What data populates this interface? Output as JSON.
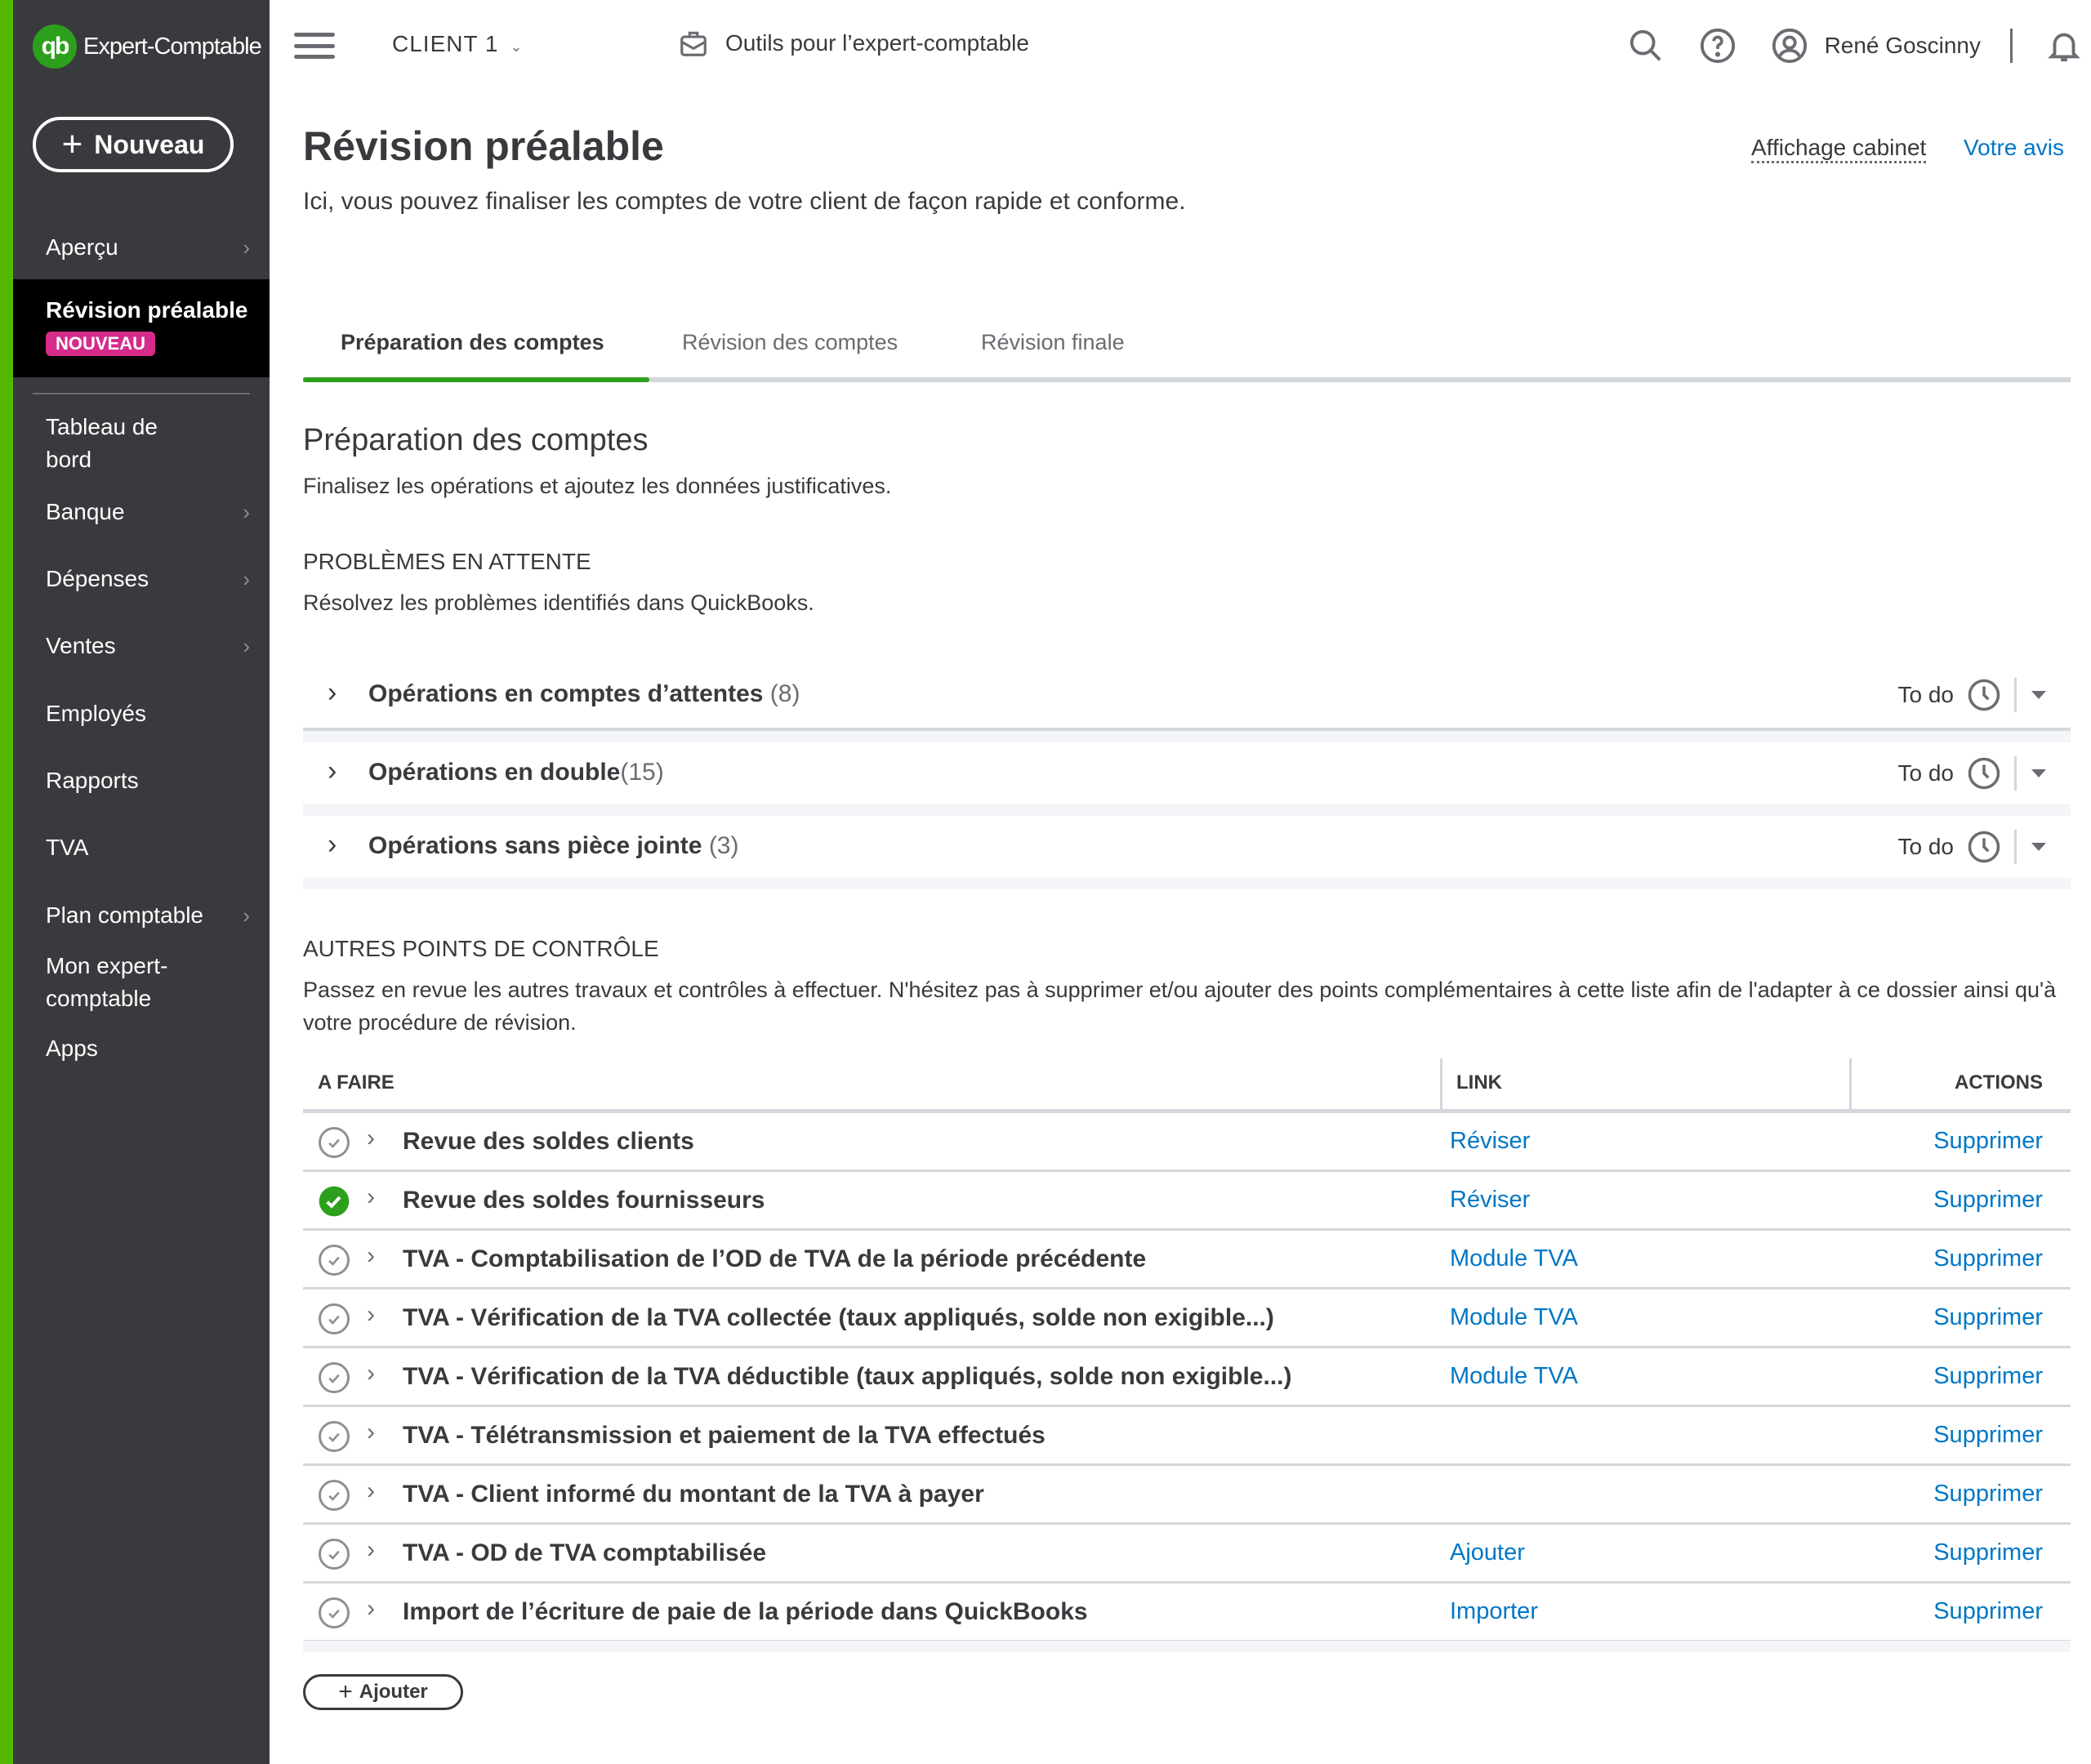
{
  "app": {
    "logo_mark": "qb",
    "logo_text": "Expert-Comptable"
  },
  "sidebar": {
    "new_button": "Nouveau",
    "items": [
      {
        "label": "Aperçu",
        "has_chevron": true
      },
      {
        "label": "Révision préalable",
        "badge": "NOUVEAU",
        "active": true
      },
      {
        "label": "Tableau de bord",
        "has_chevron": false
      },
      {
        "label": "Banque",
        "has_chevron": true
      },
      {
        "label": "Dépenses",
        "has_chevron": true
      },
      {
        "label": "Ventes",
        "has_chevron": true
      },
      {
        "label": "Employés",
        "has_chevron": false
      },
      {
        "label": "Rapports",
        "has_chevron": false
      },
      {
        "label": "TVA",
        "has_chevron": false
      },
      {
        "label": "Plan comptable",
        "has_chevron": true
      },
      {
        "label": "Mon expert-comptable",
        "has_chevron": false
      },
      {
        "label": "Apps",
        "has_chevron": false
      }
    ]
  },
  "topbar": {
    "client": "CLIENT 1",
    "tools": "Outils pour l’expert-comptable",
    "user": "René Goscinny",
    "icons": [
      "hamburger-icon",
      "briefcase-icon",
      "search-icon",
      "help-icon",
      "user-icon",
      "bell-icon"
    ]
  },
  "page": {
    "title": "Révision préalable",
    "subtitle": "Ici, vous pouvez finaliser les comptes de votre client de façon rapide et conforme.",
    "affichage": "Affichage cabinet",
    "avis": "Votre avis",
    "tabs": [
      {
        "label": "Préparation des comptes",
        "active": true
      },
      {
        "label": "Révision des comptes",
        "active": false
      },
      {
        "label": "Révision finale",
        "active": false
      }
    ],
    "section_title": "Préparation des comptes",
    "section_desc": "Finalisez les opérations et ajoutez les données justificatives."
  },
  "problems": {
    "title": "PROBLÈMES EN ATTENTE",
    "desc": "Résolvez les problèmes identifiés dans QuickBooks.",
    "rows": [
      {
        "name": "Opérations en comptes d’attentes",
        "count": "(8)",
        "status": "To do"
      },
      {
        "name": "Opérations en double",
        "count": "(15)",
        "status": "To do"
      },
      {
        "name": "Opérations sans pièce jointe",
        "count": "(3)",
        "status": "To do"
      }
    ]
  },
  "controls": {
    "title": "AUTRES POINTS DE CONTRÔLE",
    "desc": "Passez en revue les autres travaux et contrôles à effectuer. N'hésitez pas à supprimer et/ou ajouter des points complémentaires à cette liste afin de l'adapter à ce dossier ainsi qu'à votre procédure de révision.",
    "columns": {
      "todo": "A FAIRE",
      "link": "LINK",
      "actions": "ACTIONS"
    },
    "rows": [
      {
        "task": "Revue des soldes clients",
        "link": "Réviser",
        "action": "Supprimer",
        "done": false
      },
      {
        "task": "Revue des soldes fournisseurs",
        "link": "Réviser",
        "action": "Supprimer",
        "done": true
      },
      {
        "task": "TVA - Comptabilisation de l’OD de TVA de la période précédente",
        "link": "Module TVA",
        "action": "Supprimer",
        "done": false
      },
      {
        "task": "TVA - Vérification de la TVA collectée (taux appliqués, solde non exigible...)",
        "link": "Module TVA",
        "action": "Supprimer",
        "done": false
      },
      {
        "task": "TVA - Vérification de la TVA déductible (taux appliqués, solde non exigible...)",
        "link": "Module TVA",
        "action": "Supprimer",
        "done": false
      },
      {
        "task": "TVA - Télétransmission et paiement de la TVA effectués",
        "link": "",
        "action": "Supprimer",
        "done": false
      },
      {
        "task": "TVA - Client informé du montant de la TVA à payer",
        "link": "",
        "action": "Supprimer",
        "done": false
      },
      {
        "task": "TVA - OD de TVA comptabilisée",
        "link": "Ajouter",
        "action": "Supprimer",
        "done": false
      },
      {
        "task": "Import de l’écriture de paie de la période dans QuickBooks",
        "link": "Importer",
        "action": "Supprimer",
        "done": false
      }
    ],
    "add_button": "Ajouter"
  },
  "colors": {
    "brand_green": "#2ca01c",
    "sidebar": "#393a3d",
    "link": "#0077c5",
    "badge": "#d52b8b"
  }
}
